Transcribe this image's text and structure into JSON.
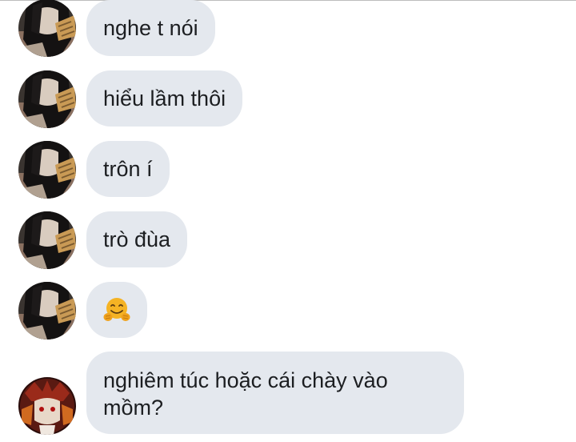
{
  "conversation": {
    "messages": [
      {
        "sender": "contact-1",
        "text": "nghe t nói"
      },
      {
        "sender": "contact-1",
        "text": "hiểu lầm thôi"
      },
      {
        "sender": "contact-1",
        "text": "trôn í"
      },
      {
        "sender": "contact-1",
        "text": "trò đùa"
      },
      {
        "sender": "contact-1",
        "text": "",
        "emoji": "hugging-face-emoji"
      },
      {
        "sender": "contact-2",
        "text": "nghiêm túc hoặc cái chày vào mồm?"
      }
    ]
  },
  "colors": {
    "bubble_background": "#e4e8ee",
    "text": "#1c1e21",
    "emoji": "#f5b324"
  }
}
